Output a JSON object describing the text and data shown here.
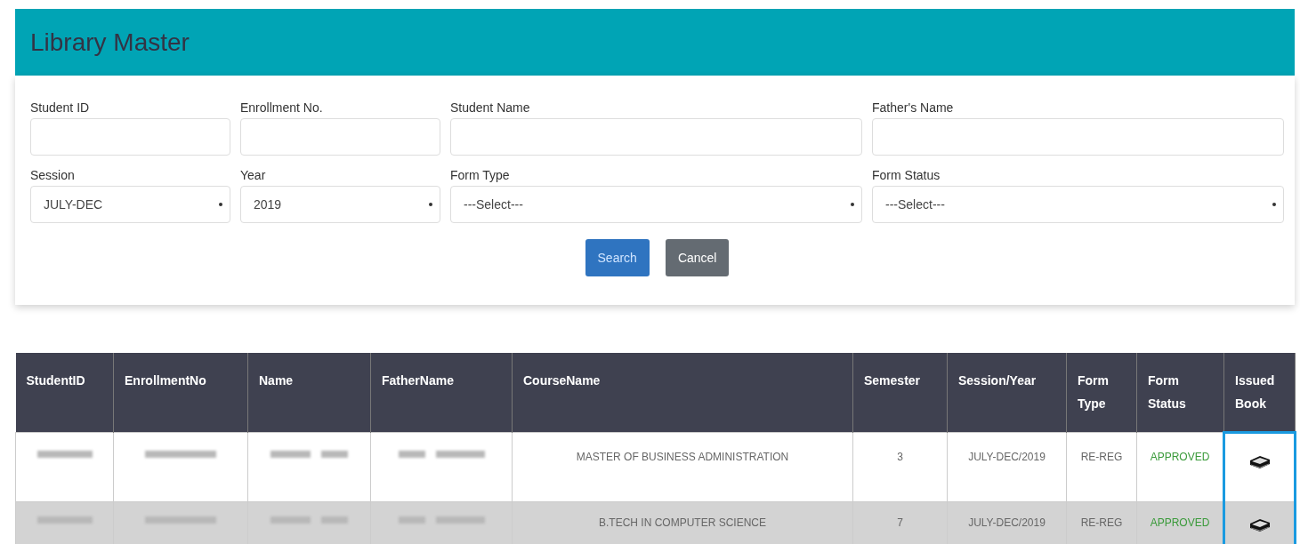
{
  "header": {
    "title": "Library Master"
  },
  "filters": [
    {
      "kind": "text",
      "label": "Student ID"
    },
    {
      "kind": "text",
      "label": "Enrollment No."
    },
    {
      "kind": "text",
      "label": "Student Name"
    },
    {
      "kind": "text",
      "label": "Father's Name"
    },
    {
      "kind": "select",
      "label": "Session",
      "value": "JULY-DEC"
    },
    {
      "kind": "select",
      "label": "Year",
      "value": "2019"
    },
    {
      "kind": "select",
      "label": "Form Type",
      "value": "---Select---"
    },
    {
      "kind": "select",
      "label": "Form Status",
      "value": "---Select---"
    }
  ],
  "buttons": [
    {
      "kind": "primary",
      "label": "Search"
    },
    {
      "kind": "secondary",
      "label": "Cancel"
    }
  ],
  "table": {
    "columns": [
      "StudentID",
      "EnrollmentNo",
      "Name",
      "FatherName",
      "CourseName",
      "Semester",
      "Session/Year",
      "Form Type",
      "Form Status",
      "Issued Book"
    ],
    "rows": [
      {
        "course": "MASTER OF BUSINESS ADMINISTRATION",
        "semester": "3",
        "session_year": "JULY-DEC/2019",
        "form_type": "RE-REG",
        "form_status": "APPROVED",
        "selected": false
      },
      {
        "course": "B.TECH IN COMPUTER SCIENCE",
        "semester": "7",
        "session_year": "JULY-DEC/2019",
        "form_type": "RE-REG",
        "form_status": "APPROVED",
        "selected": true
      }
    ],
    "issued_book_highlighted": true
  }
}
